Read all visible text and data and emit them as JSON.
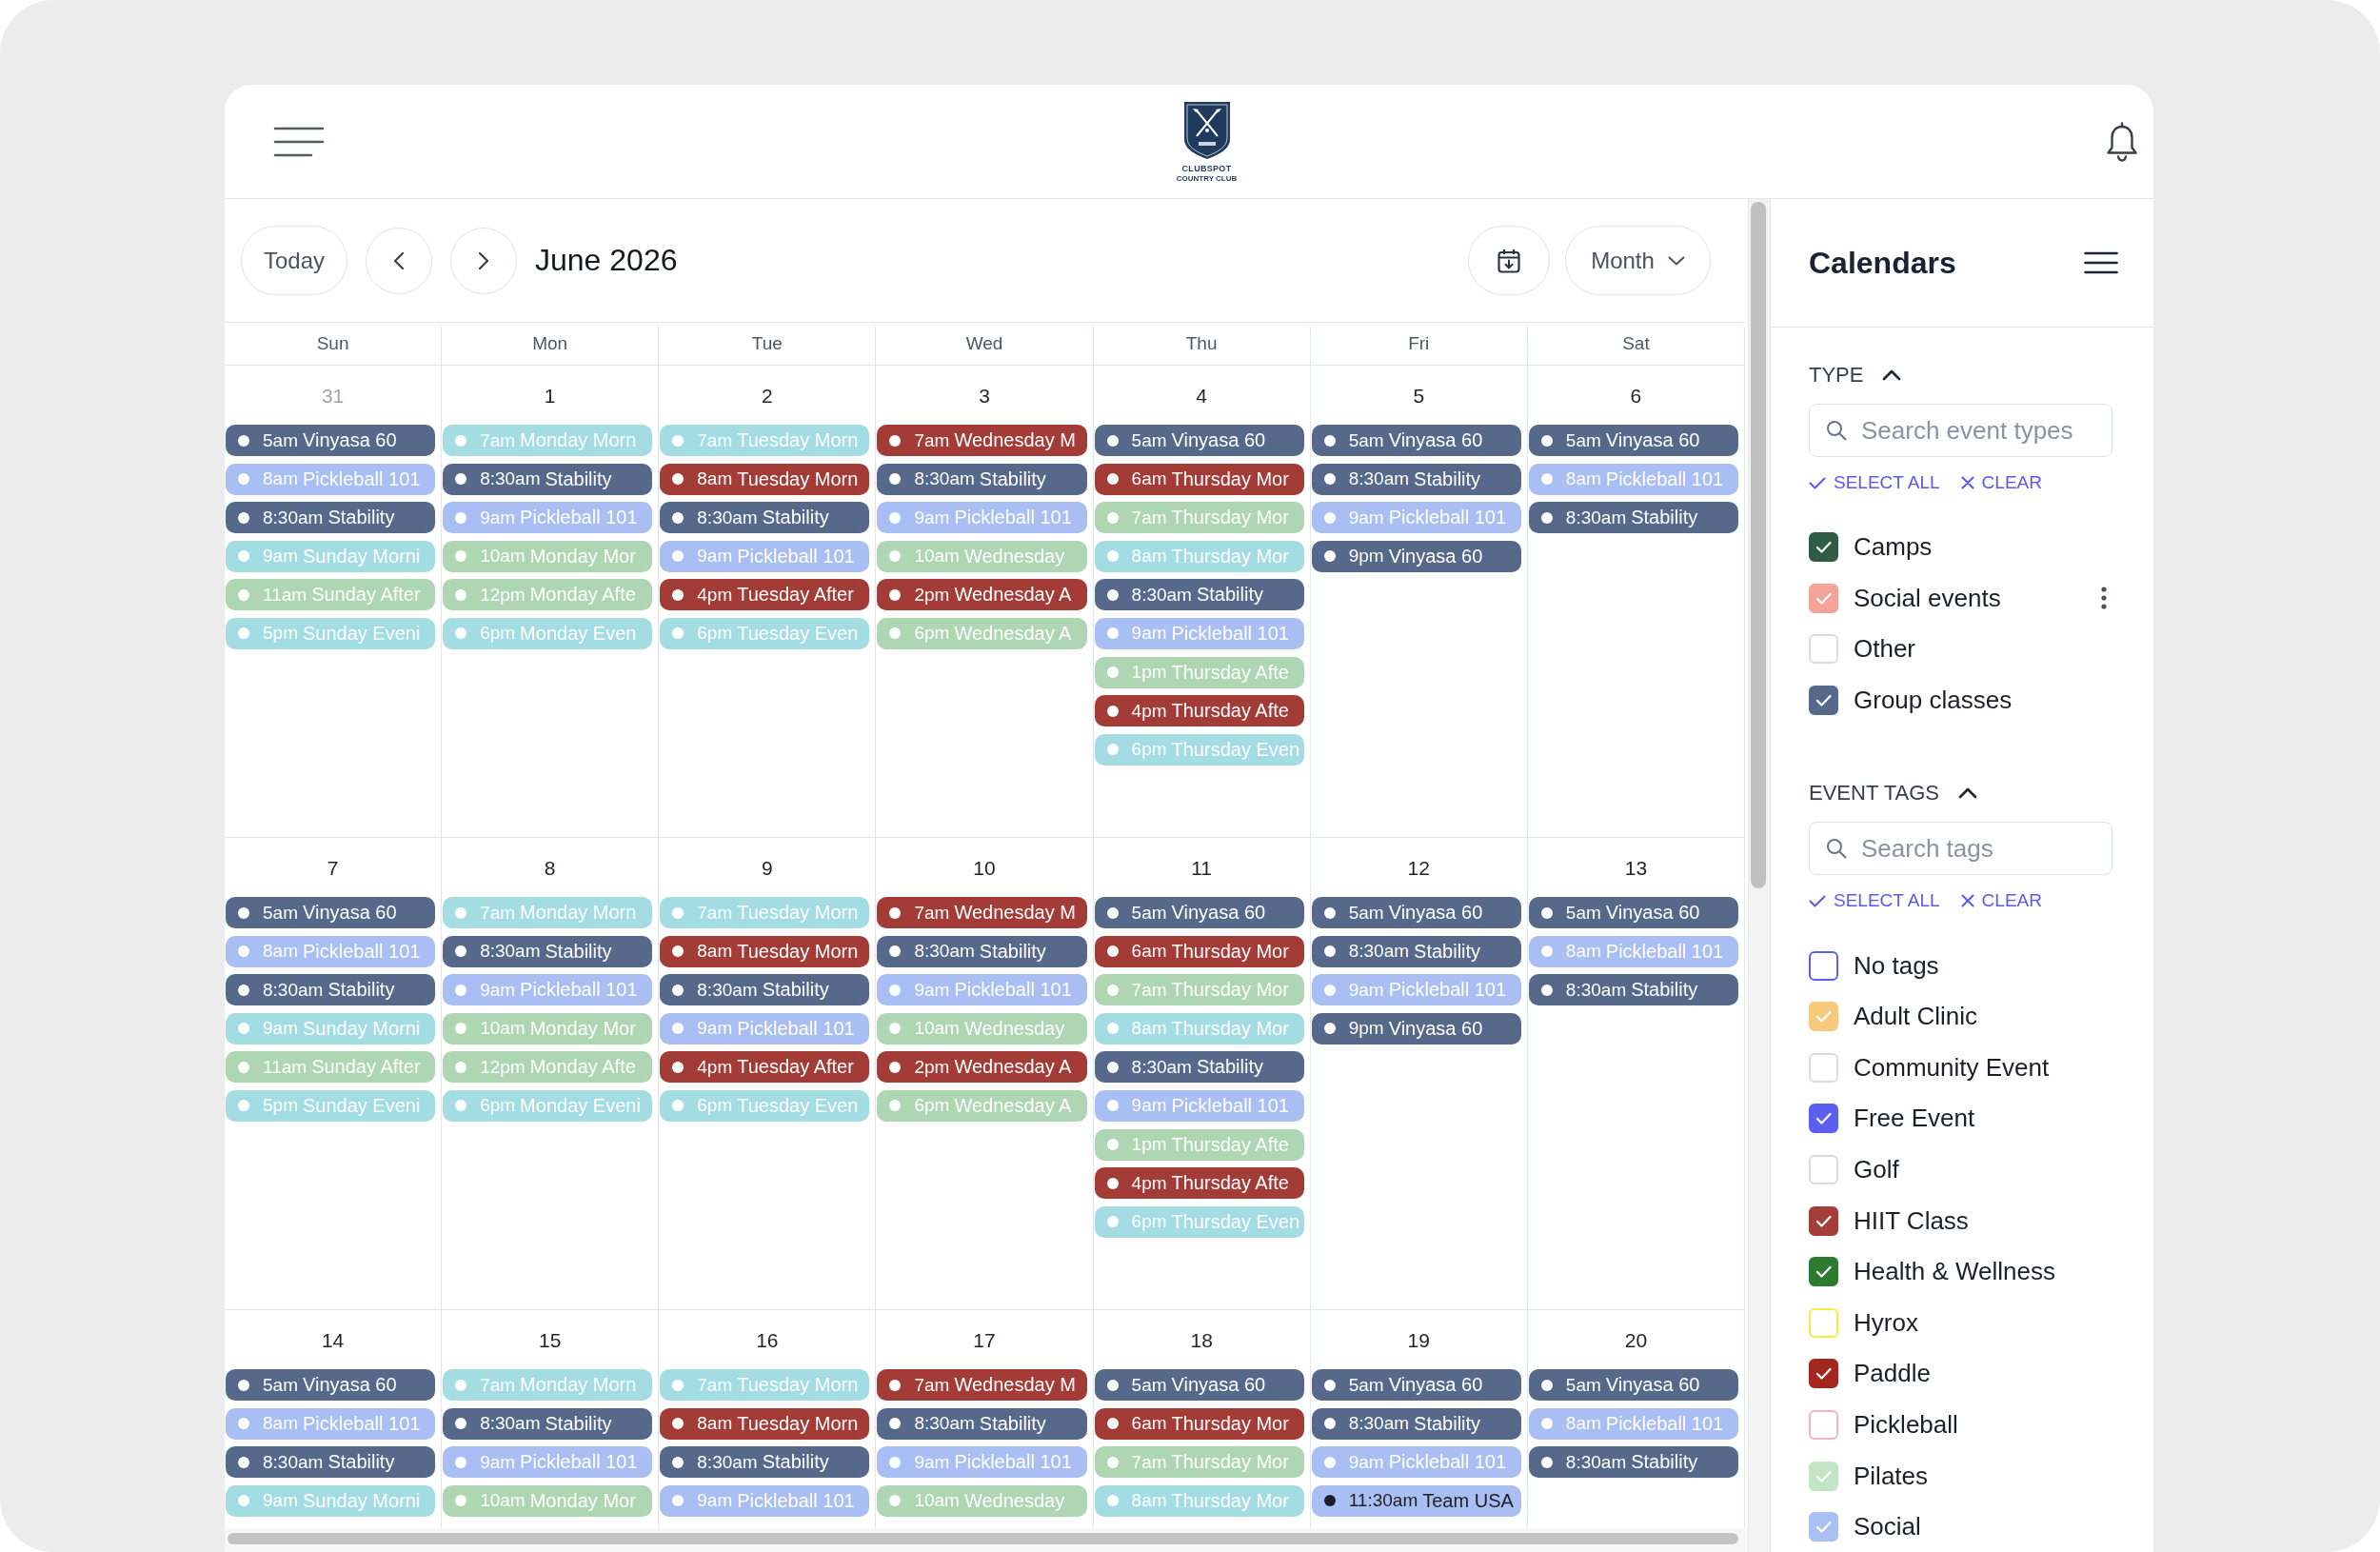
{
  "header": {
    "logo": {
      "name": "CLUBSPOT",
      "subtitle": "COUNTRY CLUB"
    }
  },
  "toolbar": {
    "today": "Today",
    "period": "June 2026",
    "view": "Month"
  },
  "calendar": {
    "weekdays": [
      "Sun",
      "Mon",
      "Tue",
      "Wed",
      "Thu",
      "Fri",
      "Sat"
    ],
    "weeks": [
      {
        "days": [
          {
            "date": "31",
            "other_month": true,
            "events": [
              {
                "time": "5am",
                "title": "Vinyasa 60",
                "color": "#56698a",
                "dark_text": false
              },
              {
                "time": "8am",
                "title": "Pickleball 101",
                "color": "#a9bef2",
                "dark_text": false
              },
              {
                "time": "8:30am",
                "title": "Stability",
                "color": "#56698a",
                "dark_text": false
              },
              {
                "time": "9am",
                "title": "Sunday Morni",
                "color": "#a3dde3",
                "dark_text": false
              },
              {
                "time": "11am",
                "title": "Sunday After",
                "color": "#aed6b2",
                "dark_text": false
              },
              {
                "time": "5pm",
                "title": "Sunday Eveni",
                "color": "#a3dde3",
                "dark_text": false
              }
            ]
          },
          {
            "date": "1",
            "other_month": false,
            "events": [
              {
                "time": "7am",
                "title": "Monday Morn",
                "color": "#a3dde3",
                "dark_text": false
              },
              {
                "time": "8:30am",
                "title": "Stability",
                "color": "#56698a",
                "dark_text": false
              },
              {
                "time": "9am",
                "title": "Pickleball 101",
                "color": "#a9bef2",
                "dark_text": false
              },
              {
                "time": "10am",
                "title": "Monday Mor",
                "color": "#aed6b2",
                "dark_text": false
              },
              {
                "time": "12pm",
                "title": "Monday Afte",
                "color": "#aed6b2",
                "dark_text": false
              },
              {
                "time": "6pm",
                "title": "Monday Even",
                "color": "#a3dde3",
                "dark_text": false
              }
            ]
          },
          {
            "date": "2",
            "other_month": false,
            "events": [
              {
                "time": "7am",
                "title": "Tuesday Morn",
                "color": "#a3dde3",
                "dark_text": false
              },
              {
                "time": "8am",
                "title": "Tuesday Morn",
                "color": "#a33b36",
                "dark_text": false
              },
              {
                "time": "8:30am",
                "title": "Stability",
                "color": "#56698a",
                "dark_text": false
              },
              {
                "time": "9am",
                "title": "Pickleball 101",
                "color": "#a9bef2",
                "dark_text": false
              },
              {
                "time": "4pm",
                "title": "Tuesday After",
                "color": "#a33b36",
                "dark_text": false
              },
              {
                "time": "6pm",
                "title": "Tuesday Even",
                "color": "#a3dde3",
                "dark_text": false
              }
            ]
          },
          {
            "date": "3",
            "other_month": false,
            "events": [
              {
                "time": "7am",
                "title": "Wednesday M",
                "color": "#a33b36",
                "dark_text": false
              },
              {
                "time": "8:30am",
                "title": "Stability",
                "color": "#56698a",
                "dark_text": false
              },
              {
                "time": "9am",
                "title": "Pickleball 101",
                "color": "#a9bef2",
                "dark_text": false
              },
              {
                "time": "10am",
                "title": "Wednesday",
                "color": "#aed6b2",
                "dark_text": false
              },
              {
                "time": "2pm",
                "title": "Wednesday A",
                "color": "#a33b36",
                "dark_text": false
              },
              {
                "time": "6pm",
                "title": "Wednesday A",
                "color": "#aed6b2",
                "dark_text": false
              }
            ]
          },
          {
            "date": "4",
            "other_month": false,
            "events": [
              {
                "time": "5am",
                "title": "Vinyasa 60",
                "color": "#56698a",
                "dark_text": false
              },
              {
                "time": "6am",
                "title": "Thursday Mor",
                "color": "#a33b36",
                "dark_text": false
              },
              {
                "time": "7am",
                "title": "Thursday Mor",
                "color": "#aed6b2",
                "dark_text": false
              },
              {
                "time": "8am",
                "title": "Thursday Mor",
                "color": "#a3dde3",
                "dark_text": false
              },
              {
                "time": "8:30am",
                "title": "Stability",
                "color": "#56698a",
                "dark_text": false
              },
              {
                "time": "9am",
                "title": "Pickleball 101",
                "color": "#a9bef2",
                "dark_text": false
              },
              {
                "time": "1pm",
                "title": "Thursday Afte",
                "color": "#aed6b2",
                "dark_text": false
              },
              {
                "time": "4pm",
                "title": "Thursday Afte",
                "color": "#a33b36",
                "dark_text": false
              },
              {
                "time": "6pm",
                "title": "Thursday Even",
                "color": "#a3dde3",
                "dark_text": false
              }
            ]
          },
          {
            "date": "5",
            "other_month": false,
            "events": [
              {
                "time": "5am",
                "title": "Vinyasa 60",
                "color": "#56698a",
                "dark_text": false
              },
              {
                "time": "8:30am",
                "title": "Stability",
                "color": "#56698a",
                "dark_text": false
              },
              {
                "time": "9am",
                "title": "Pickleball 101",
                "color": "#a9bef2",
                "dark_text": false
              },
              {
                "time": "9pm",
                "title": "Vinyasa 60",
                "color": "#56698a",
                "dark_text": false
              }
            ]
          },
          {
            "date": "6",
            "other_month": false,
            "events": [
              {
                "time": "5am",
                "title": "Vinyasa 60",
                "color": "#56698a",
                "dark_text": false
              },
              {
                "time": "8am",
                "title": "Pickleball 101",
                "color": "#a9bef2",
                "dark_text": false
              },
              {
                "time": "8:30am",
                "title": "Stability",
                "color": "#56698a",
                "dark_text": false
              }
            ]
          }
        ]
      },
      {
        "days": [
          {
            "date": "7",
            "other_month": false,
            "events": [
              {
                "time": "5am",
                "title": "Vinyasa 60",
                "color": "#56698a",
                "dark_text": false
              },
              {
                "time": "8am",
                "title": "Pickleball 101",
                "color": "#a9bef2",
                "dark_text": false
              },
              {
                "time": "8:30am",
                "title": "Stability",
                "color": "#56698a",
                "dark_text": false
              },
              {
                "time": "9am",
                "title": "Sunday Morni",
                "color": "#a3dde3",
                "dark_text": false
              },
              {
                "time": "11am",
                "title": "Sunday After",
                "color": "#aed6b2",
                "dark_text": false
              },
              {
                "time": "5pm",
                "title": "Sunday Eveni",
                "color": "#a3dde3",
                "dark_text": false
              }
            ]
          },
          {
            "date": "8",
            "other_month": false,
            "events": [
              {
                "time": "7am",
                "title": "Monday Morn",
                "color": "#a3dde3",
                "dark_text": false
              },
              {
                "time": "8:30am",
                "title": "Stability",
                "color": "#56698a",
                "dark_text": false
              },
              {
                "time": "9am",
                "title": "Pickleball 101",
                "color": "#a9bef2",
                "dark_text": false
              },
              {
                "time": "10am",
                "title": "Monday Mor",
                "color": "#aed6b2",
                "dark_text": false
              },
              {
                "time": "12pm",
                "title": "Monday Afte",
                "color": "#aed6b2",
                "dark_text": false
              },
              {
                "time": "6pm",
                "title": "Monday Eveni",
                "color": "#a3dde3",
                "dark_text": false
              }
            ]
          },
          {
            "date": "9",
            "other_month": false,
            "events": [
              {
                "time": "7am",
                "title": "Tuesday Morn",
                "color": "#a3dde3",
                "dark_text": false
              },
              {
                "time": "8am",
                "title": "Tuesday Morn",
                "color": "#a33b36",
                "dark_text": false
              },
              {
                "time": "8:30am",
                "title": "Stability",
                "color": "#56698a",
                "dark_text": false
              },
              {
                "time": "9am",
                "title": "Pickleball 101",
                "color": "#a9bef2",
                "dark_text": false
              },
              {
                "time": "4pm",
                "title": "Tuesday After",
                "color": "#a33b36",
                "dark_text": false
              },
              {
                "time": "6pm",
                "title": "Tuesday Even",
                "color": "#a3dde3",
                "dark_text": false
              }
            ]
          },
          {
            "date": "10",
            "other_month": false,
            "events": [
              {
                "time": "7am",
                "title": "Wednesday M",
                "color": "#a33b36",
                "dark_text": false
              },
              {
                "time": "8:30am",
                "title": "Stability",
                "color": "#56698a",
                "dark_text": false
              },
              {
                "time": "9am",
                "title": "Pickleball 101",
                "color": "#a9bef2",
                "dark_text": false
              },
              {
                "time": "10am",
                "title": "Wednesday",
                "color": "#aed6b2",
                "dark_text": false
              },
              {
                "time": "2pm",
                "title": "Wednesday A",
                "color": "#a33b36",
                "dark_text": false
              },
              {
                "time": "6pm",
                "title": "Wednesday A",
                "color": "#aed6b2",
                "dark_text": false
              }
            ]
          },
          {
            "date": "11",
            "other_month": false,
            "events": [
              {
                "time": "5am",
                "title": "Vinyasa 60",
                "color": "#56698a",
                "dark_text": false
              },
              {
                "time": "6am",
                "title": "Thursday Mor",
                "color": "#a33b36",
                "dark_text": false
              },
              {
                "time": "7am",
                "title": "Thursday Mor",
                "color": "#aed6b2",
                "dark_text": false
              },
              {
                "time": "8am",
                "title": "Thursday Mor",
                "color": "#a3dde3",
                "dark_text": false
              },
              {
                "time": "8:30am",
                "title": "Stability",
                "color": "#56698a",
                "dark_text": false
              },
              {
                "time": "9am",
                "title": "Pickleball 101",
                "color": "#a9bef2",
                "dark_text": false
              },
              {
                "time": "1pm",
                "title": "Thursday Afte",
                "color": "#aed6b2",
                "dark_text": false
              },
              {
                "time": "4pm",
                "title": "Thursday Afte",
                "color": "#a33b36",
                "dark_text": false
              },
              {
                "time": "6pm",
                "title": "Thursday Even",
                "color": "#a3dde3",
                "dark_text": false
              }
            ]
          },
          {
            "date": "12",
            "other_month": false,
            "events": [
              {
                "time": "5am",
                "title": "Vinyasa 60",
                "color": "#56698a",
                "dark_text": false
              },
              {
                "time": "8:30am",
                "title": "Stability",
                "color": "#56698a",
                "dark_text": false
              },
              {
                "time": "9am",
                "title": "Pickleball 101",
                "color": "#a9bef2",
                "dark_text": false
              },
              {
                "time": "9pm",
                "title": "Vinyasa 60",
                "color": "#56698a",
                "dark_text": false
              }
            ]
          },
          {
            "date": "13",
            "other_month": false,
            "events": [
              {
                "time": "5am",
                "title": "Vinyasa 60",
                "color": "#56698a",
                "dark_text": false
              },
              {
                "time": "8am",
                "title": "Pickleball 101",
                "color": "#a9bef2",
                "dark_text": false
              },
              {
                "time": "8:30am",
                "title": "Stability",
                "color": "#56698a",
                "dark_text": false
              }
            ]
          }
        ]
      },
      {
        "days": [
          {
            "date": "14",
            "other_month": false,
            "events": [
              {
                "time": "5am",
                "title": "Vinyasa 60",
                "color": "#56698a",
                "dark_text": false
              },
              {
                "time": "8am",
                "title": "Pickleball 101",
                "color": "#a9bef2",
                "dark_text": false
              },
              {
                "time": "8:30am",
                "title": "Stability",
                "color": "#56698a",
                "dark_text": false
              },
              {
                "time": "9am",
                "title": "Sunday Morni",
                "color": "#a3dde3",
                "dark_text": false
              }
            ]
          },
          {
            "date": "15",
            "other_month": false,
            "events": [
              {
                "time": "7am",
                "title": "Monday Morn",
                "color": "#a3dde3",
                "dark_text": false
              },
              {
                "time": "8:30am",
                "title": "Stability",
                "color": "#56698a",
                "dark_text": false
              },
              {
                "time": "9am",
                "title": "Pickleball 101",
                "color": "#a9bef2",
                "dark_text": false
              },
              {
                "time": "10am",
                "title": "Monday Mor",
                "color": "#aed6b2",
                "dark_text": false
              }
            ]
          },
          {
            "date": "16",
            "other_month": false,
            "events": [
              {
                "time": "7am",
                "title": "Tuesday Morn",
                "color": "#a3dde3",
                "dark_text": false
              },
              {
                "time": "8am",
                "title": "Tuesday Morn",
                "color": "#a33b36",
                "dark_text": false
              },
              {
                "time": "8:30am",
                "title": "Stability",
                "color": "#56698a",
                "dark_text": false
              },
              {
                "time": "9am",
                "title": "Pickleball 101",
                "color": "#a9bef2",
                "dark_text": false
              }
            ]
          },
          {
            "date": "17",
            "other_month": false,
            "events": [
              {
                "time": "7am",
                "title": "Wednesday M",
                "color": "#a33b36",
                "dark_text": false
              },
              {
                "time": "8:30am",
                "title": "Stability",
                "color": "#56698a",
                "dark_text": false
              },
              {
                "time": "9am",
                "title": "Pickleball 101",
                "color": "#a9bef2",
                "dark_text": false
              },
              {
                "time": "10am",
                "title": "Wednesday",
                "color": "#aed6b2",
                "dark_text": false
              }
            ]
          },
          {
            "date": "18",
            "other_month": false,
            "events": [
              {
                "time": "5am",
                "title": "Vinyasa 60",
                "color": "#56698a",
                "dark_text": false
              },
              {
                "time": "6am",
                "title": "Thursday Mor",
                "color": "#a33b36",
                "dark_text": false
              },
              {
                "time": "7am",
                "title": "Thursday Mor",
                "color": "#aed6b2",
                "dark_text": false
              },
              {
                "time": "8am",
                "title": "Thursday Mor",
                "color": "#a3dde3",
                "dark_text": false
              }
            ]
          },
          {
            "date": "19",
            "other_month": false,
            "events": [
              {
                "time": "5am",
                "title": "Vinyasa 60",
                "color": "#56698a",
                "dark_text": false
              },
              {
                "time": "8:30am",
                "title": "Stability",
                "color": "#56698a",
                "dark_text": false
              },
              {
                "time": "9am",
                "title": "Pickleball 101",
                "color": "#a9bef2",
                "dark_text": false
              },
              {
                "time": "11:30am",
                "title": "Team USA",
                "color": "#a9bef2",
                "dark_text": true
              }
            ]
          },
          {
            "date": "20",
            "other_month": false,
            "events": [
              {
                "time": "5am",
                "title": "Vinyasa 60",
                "color": "#56698a",
                "dark_text": false
              },
              {
                "time": "8am",
                "title": "Pickleball 101",
                "color": "#a9bef2",
                "dark_text": false
              },
              {
                "time": "8:30am",
                "title": "Stability",
                "color": "#56698a",
                "dark_text": false
              }
            ]
          }
        ]
      }
    ]
  },
  "sidebar": {
    "title": "Calendars",
    "sections": [
      {
        "title": "TYPE",
        "expanded": true,
        "search_placeholder": "Search event types",
        "select_all": "SELECT ALL",
        "clear": "CLEAR",
        "items": [
          {
            "label": "Camps",
            "checked": true,
            "color": "#2f5b47",
            "hovered": false
          },
          {
            "label": "Social events",
            "checked": true,
            "color": "#f4a398",
            "hovered": true
          },
          {
            "label": "Other",
            "checked": false,
            "color": "#d9dde3",
            "hovered": false
          },
          {
            "label": "Group classes",
            "checked": true,
            "color": "#56698a",
            "hovered": false
          }
        ]
      },
      {
        "title": "EVENT TAGS",
        "expanded": true,
        "search_placeholder": "Search tags",
        "select_all": "SELECT ALL",
        "clear": "CLEAR",
        "items": [
          {
            "label": "No tags",
            "checked": false,
            "color": "#5b5ff0",
            "hovered": false
          },
          {
            "label": "Adult Clinic",
            "checked": true,
            "color": "#f6c97c",
            "hovered": false
          },
          {
            "label": "Community Event",
            "checked": false,
            "color": "#d9dde3",
            "hovered": false
          },
          {
            "label": "Free Event",
            "checked": true,
            "color": "#5b5ff0",
            "hovered": false
          },
          {
            "label": "Golf",
            "checked": false,
            "color": "#d9dde3",
            "hovered": false
          },
          {
            "label": "HIIT Class",
            "checked": true,
            "color": "#a33f3a",
            "hovered": false
          },
          {
            "label": "Health & Wellness",
            "checked": true,
            "color": "#2e7a2e",
            "hovered": false
          },
          {
            "label": "Hyrox",
            "checked": false,
            "color": "#f2f03c",
            "hovered": false
          },
          {
            "label": "Paddle",
            "checked": true,
            "color": "#a3261f",
            "hovered": false
          },
          {
            "label": "Pickleball",
            "checked": false,
            "color": "#f2b3c6",
            "hovered": false
          },
          {
            "label": "Pilates",
            "checked": true,
            "color": "#c3e4c5",
            "hovered": false
          },
          {
            "label": "Social",
            "checked": true,
            "color": "#a9c0f2",
            "hovered": false
          }
        ]
      }
    ]
  }
}
